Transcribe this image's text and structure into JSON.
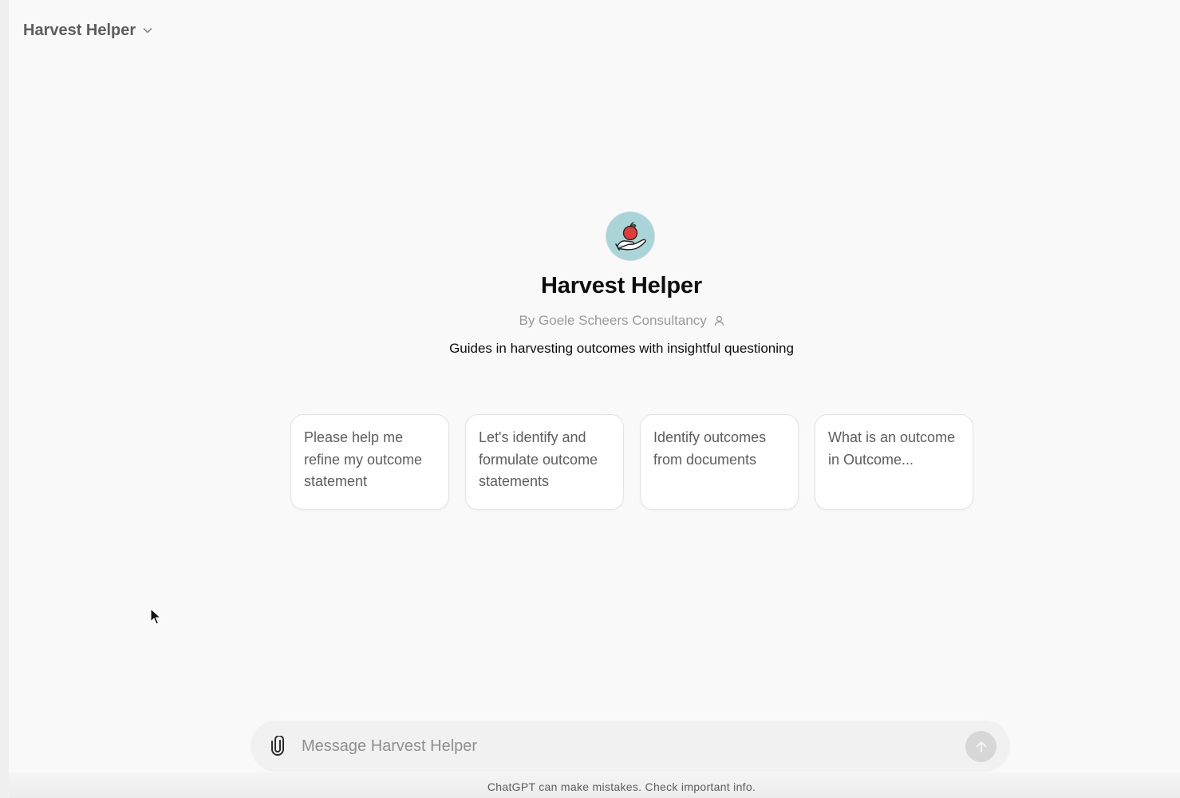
{
  "header": {
    "model_name": "Harvest Helper",
    "chevron_icon": "chevron-down-icon"
  },
  "gpt": {
    "avatar_icon": "hand-holding-apple-icon",
    "name": "Harvest Helper",
    "author": "By Goele Scheers Consultancy",
    "author_icon": "person-icon",
    "description": "Guides in harvesting outcomes with insightful questioning"
  },
  "starters": [
    {
      "label": "Please help me refine my outcome statement"
    },
    {
      "label": "Let's identify and formulate outcome statements"
    },
    {
      "label": "Identify outcomes from documents"
    },
    {
      "label": "What is an outcome in Outcome..."
    }
  ],
  "composer": {
    "placeholder": "Message Harvest Helper",
    "value": "",
    "attach_icon": "paperclip-icon",
    "send_icon": "arrow-up-icon"
  },
  "footer": {
    "disclaimer": "ChatGPT can make mistakes. Check important info."
  },
  "colors": {
    "background": "#f9f9f9",
    "avatar_bg": "#a9d4d8",
    "send_disabled": "#d7d7d7",
    "apple_red": "#e03c3c"
  }
}
